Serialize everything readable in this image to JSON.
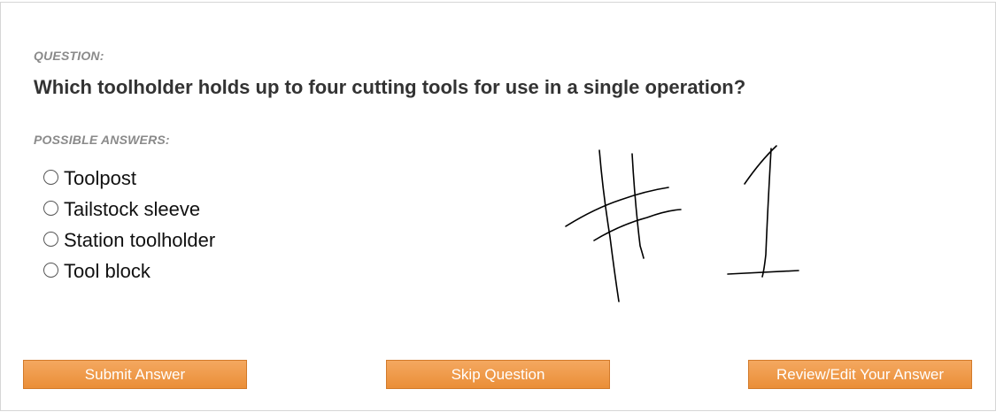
{
  "question": {
    "label": "QUESTION:",
    "text": "Which toolholder holds up to four cutting tools for use in a single operation?"
  },
  "answers": {
    "label": "POSSIBLE ANSWERS:",
    "options": [
      {
        "text": "Toolpost"
      },
      {
        "text": "Tailstock sleeve"
      },
      {
        "text": "Station toolholder"
      },
      {
        "text": "Tool block"
      }
    ]
  },
  "buttons": {
    "submit": "Submit Answer",
    "skip": "Skip Question",
    "review": "Review/Edit Your Answer"
  },
  "colors": {
    "button_bg": "#ea8e37",
    "button_border": "#d27a2a",
    "label_gray": "#8a8a8a",
    "question_text": "#333333"
  },
  "annotation": {
    "handwritten_text": "#1"
  }
}
